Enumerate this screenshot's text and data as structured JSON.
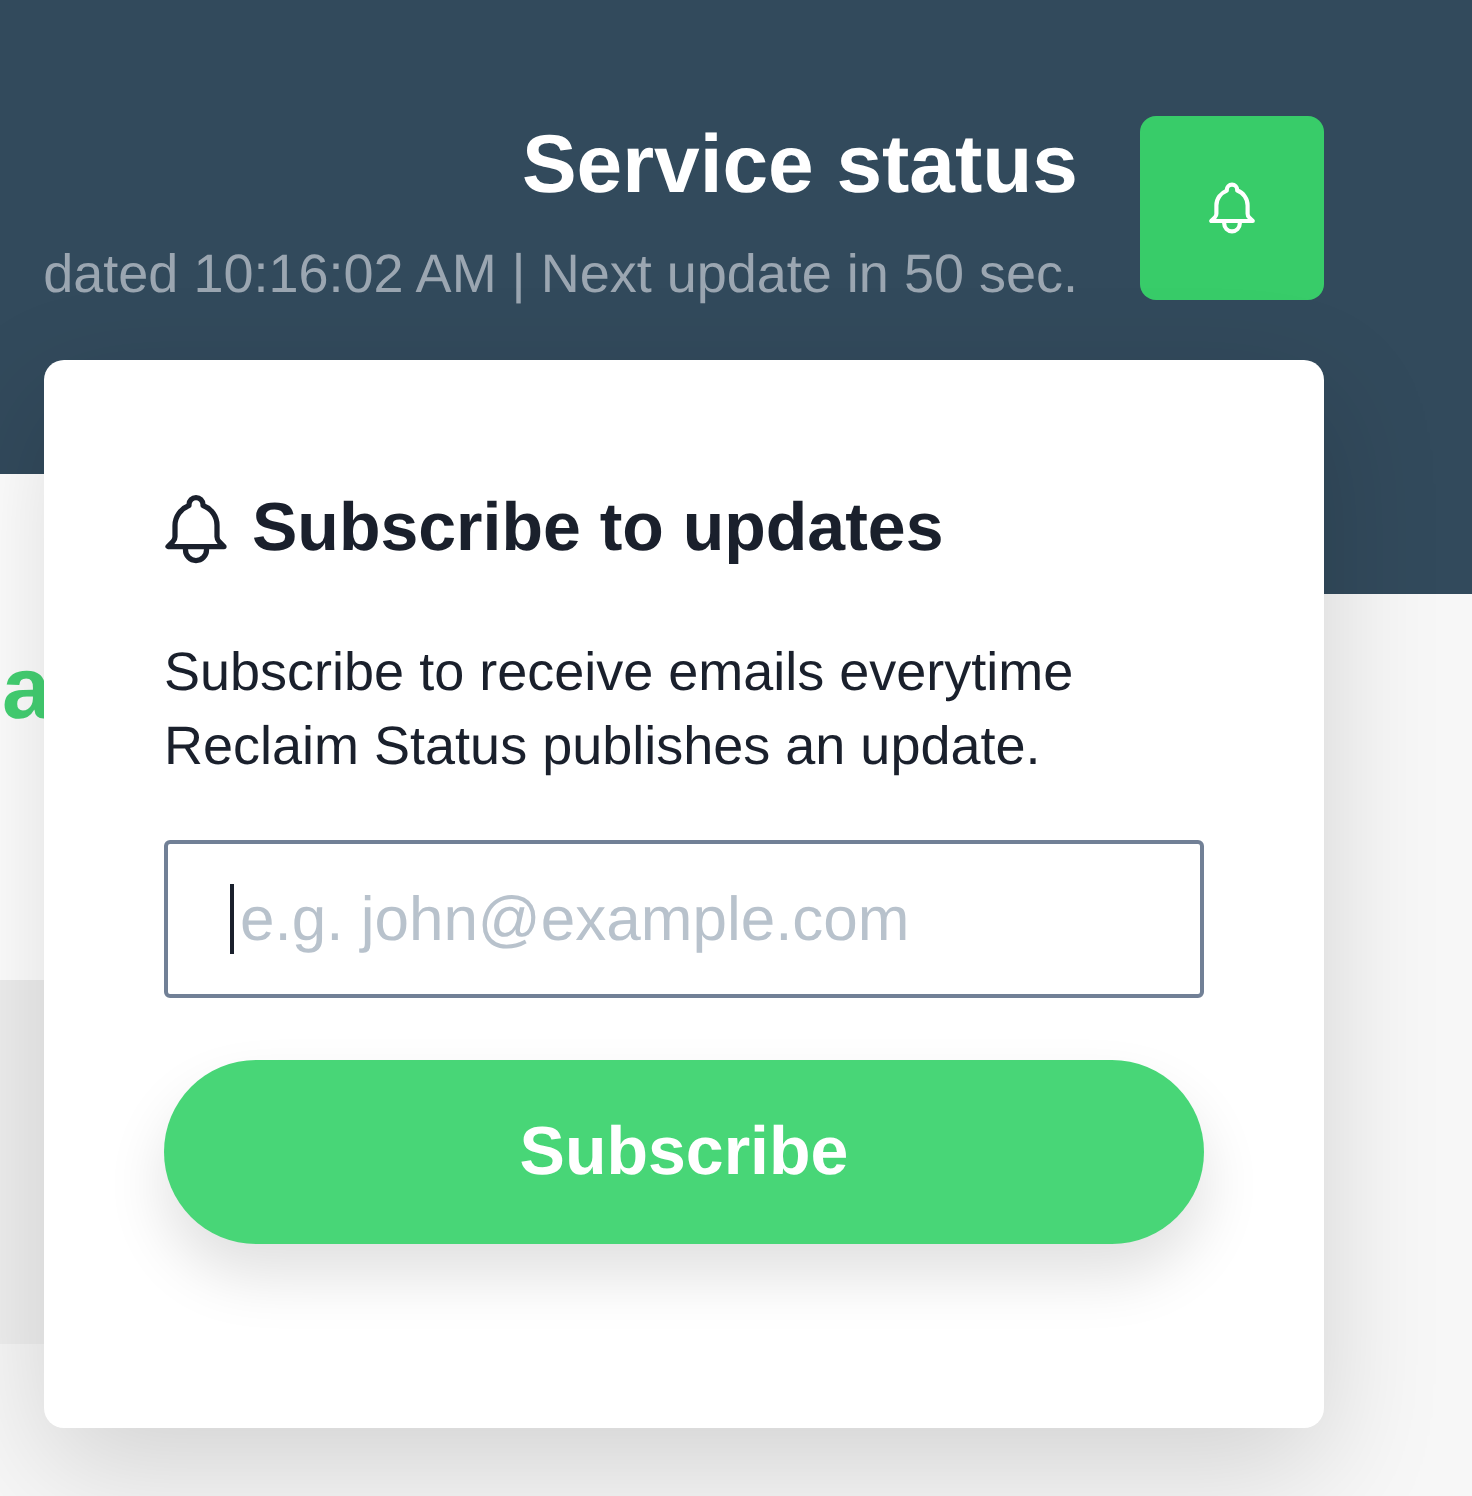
{
  "header": {
    "title": "Service status",
    "subtitle": "dated 10:16:02 AM | Next update in 50 sec."
  },
  "content": {
    "heading_fragment": "a"
  },
  "subscribe_popover": {
    "title": "Subscribe to updates",
    "description": "Subscribe to receive emails everytime Reclaim Status publishes an update.",
    "email_field": {
      "placeholder": "e.g. john@example.com",
      "focused": true
    },
    "button": "Subscribe"
  }
}
